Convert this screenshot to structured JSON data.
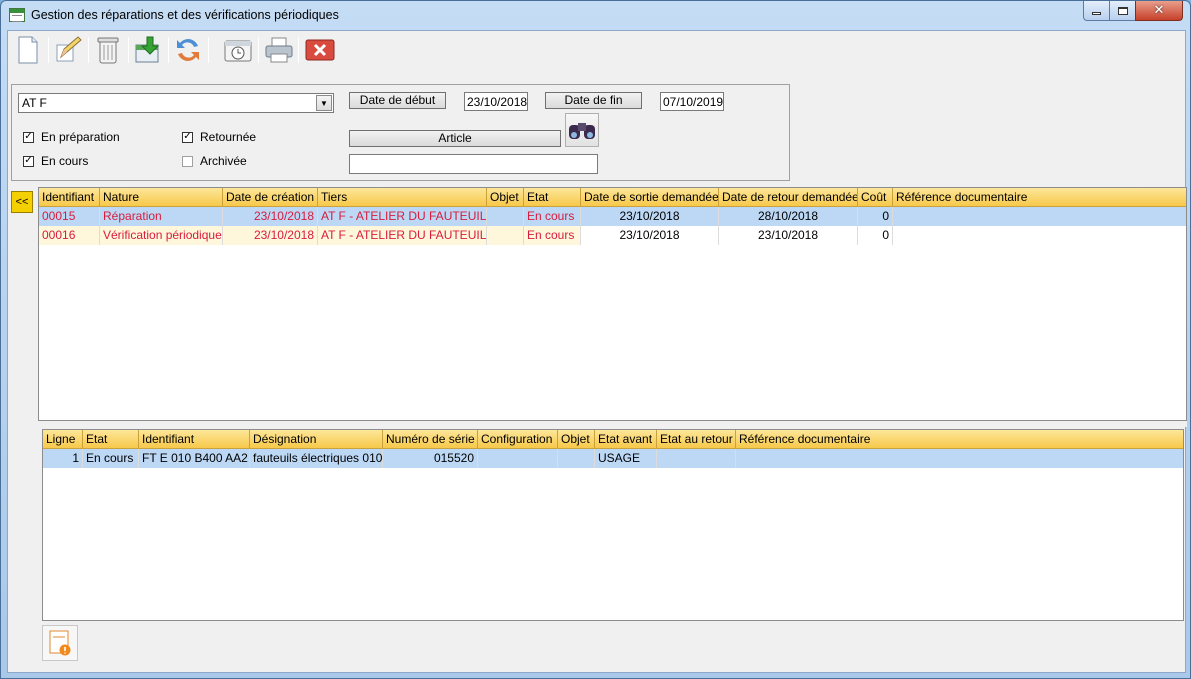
{
  "window": {
    "title": "Gestion des réparations et des vérifications périodiques",
    "controls": {
      "minimize": "",
      "maximize": "",
      "close": "✕"
    }
  },
  "toolbar": {
    "buttons": [
      "new-icon",
      "edit-icon",
      "delete-icon",
      "export-icon",
      "refresh-icon",
      "calendar-icon",
      "print-icon",
      "close-icon"
    ]
  },
  "filters": {
    "tiers_value": "AT F",
    "date_debut_label": "Date de début",
    "date_debut_value": "23/10/2018",
    "date_fin_label": "Date de fin",
    "date_fin_value": "07/10/2019",
    "article_label": "Article",
    "article_value": "",
    "checks": {
      "en_preparation": {
        "label": "En préparation",
        "checked": true
      },
      "en_cours": {
        "label": "En cours",
        "checked": true
      },
      "retournee": {
        "label": "Retournée",
        "checked": true
      },
      "archivee": {
        "label": "Archivée",
        "checked": false
      }
    }
  },
  "collapse_label": "<<",
  "orders_table": {
    "columns": [
      "Identifiant",
      "Nature",
      "Date de création",
      "Tiers",
      "Objet",
      "Etat",
      "Date de sortie demandée",
      "Date de retour demandée",
      "Coût",
      "Référence documentaire"
    ],
    "rows": [
      {
        "id": "00015",
        "nature": "Réparation",
        "date_creation": "23/10/2018",
        "tiers": "AT F - ATELIER DU FAUTEUIL",
        "objet": "",
        "etat": "En cours",
        "date_sortie": "23/10/2018",
        "date_retour": "28/10/2018",
        "cout": "0",
        "reference": ""
      },
      {
        "id": "00016",
        "nature": "Vérification périodique",
        "date_creation": "23/10/2018",
        "tiers": "AT F - ATELIER DU FAUTEUIL",
        "objet": "",
        "etat": "En cours",
        "date_sortie": "23/10/2018",
        "date_retour": "23/10/2018",
        "cout": "0",
        "reference": ""
      }
    ]
  },
  "lines_table": {
    "columns": [
      "Ligne",
      "Etat",
      "Identifiant",
      "Désignation",
      "Numéro de série",
      "Configuration",
      "Objet",
      "Etat avant",
      "Etat au retour",
      "Référence documentaire"
    ],
    "rows": [
      {
        "ligne": "1",
        "etat": "En cours",
        "identifiant": "FT E 010 B400 AA2",
        "designation": "fauteuils électriques 010",
        "numero_serie": "015520",
        "configuration": "",
        "objet": "",
        "etat_avant": "USAGE",
        "etat_retour": "",
        "reference": ""
      }
    ]
  },
  "colors": {
    "header": "#f7c84a",
    "selected_row": "#bcd8f5",
    "alt_row": "#fff7dc",
    "red_text": "#d81b3c",
    "collapse_button": "#f5d000"
  }
}
